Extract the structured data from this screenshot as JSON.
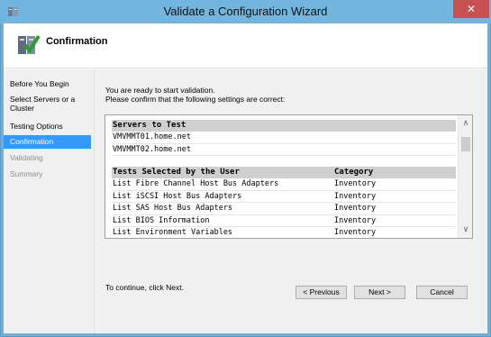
{
  "window": {
    "title": "Validate a Configuration Wizard",
    "close_label": "✕"
  },
  "header": {
    "title": "Confirmation",
    "icon": "cluster-check-icon"
  },
  "nav": {
    "items": [
      {
        "label": "Before You Begin",
        "state": "normal"
      },
      {
        "label": "Select Servers or a Cluster",
        "state": "normal"
      },
      {
        "label": "Testing Options",
        "state": "normal"
      },
      {
        "label": "Confirmation",
        "state": "active"
      },
      {
        "label": "Validating",
        "state": "disabled"
      },
      {
        "label": "Summary",
        "state": "disabled"
      }
    ]
  },
  "main": {
    "intro_line1": "You are ready to start validation.",
    "intro_line2": "Please confirm that the following settings are correct:",
    "servers_header": "Servers to Test",
    "servers": [
      "VMVMMT01.home.net",
      "VMVMMT02.home.net"
    ],
    "tests_header": "Tests Selected by the User",
    "category_header": "Category",
    "tests": [
      {
        "name": "List Fibre Channel Host Bus Adapters",
        "category": "Inventory"
      },
      {
        "name": "List iSCSI Host Bus Adapters",
        "category": "Inventory"
      },
      {
        "name": "List SAS Host Bus Adapters",
        "category": "Inventory"
      },
      {
        "name": "List BIOS Information",
        "category": "Inventory"
      },
      {
        "name": "List Environment Variables",
        "category": "Inventory"
      }
    ],
    "continue_text": "To continue, click Next."
  },
  "buttons": {
    "previous": "< Previous",
    "next": "Next >",
    "cancel": "Cancel"
  },
  "colors": {
    "titlebar": "#72b5df",
    "close": "#c75050",
    "nav_active": "#3399ff"
  }
}
